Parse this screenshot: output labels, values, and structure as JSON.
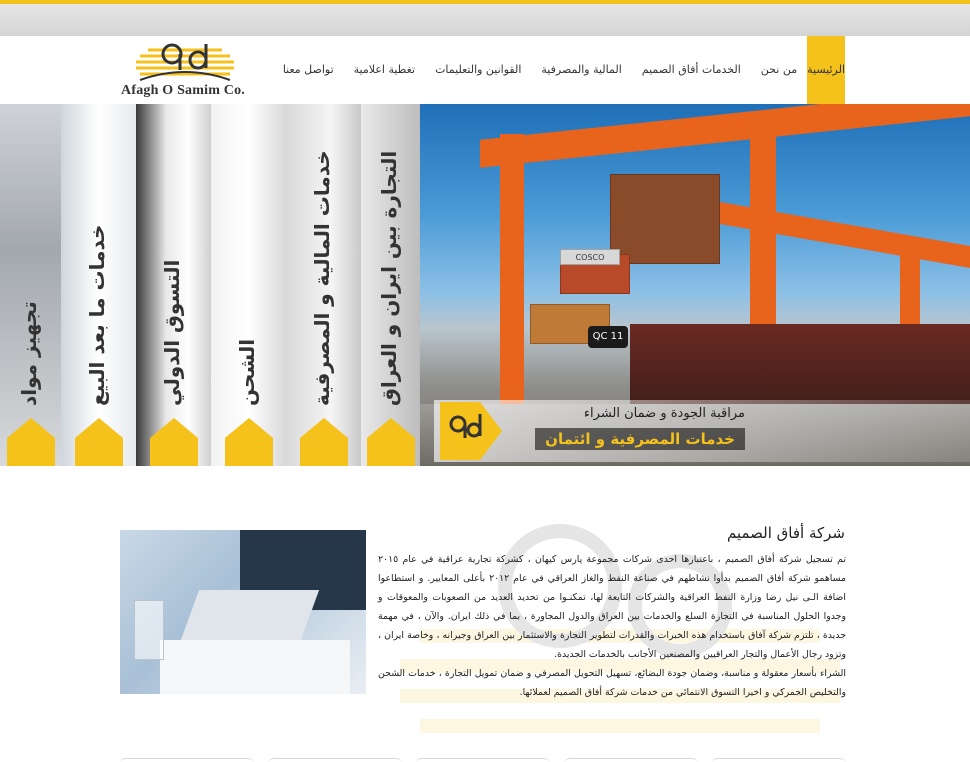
{
  "header": {
    "logo_text": "Afagh O Samim Co."
  },
  "nav": {
    "items": [
      {
        "label": "الرئيسية",
        "active": true
      },
      {
        "label": "من نحن",
        "active": false
      },
      {
        "label": "الخدمات أفاق الصميم",
        "active": false
      },
      {
        "label": "المالية والمصرفية",
        "active": false
      },
      {
        "label": "القوانين والتعليمات",
        "active": false
      },
      {
        "label": "تغطية اعلامية",
        "active": false
      },
      {
        "label": "تواصل معنا",
        "active": false
      }
    ]
  },
  "banner": {
    "strips": [
      {
        "label": "التجارة بين ايران و العراق"
      },
      {
        "label": "خدمات المالية و المصرفية"
      },
      {
        "label": "الشحن"
      },
      {
        "label": "التسوق الدولي"
      },
      {
        "label": "خدمات ما بعد البيع"
      },
      {
        "label": "تجهيز مواد"
      }
    ],
    "caption_line1": "مراقبة الجودة و ضمان الشراء",
    "caption_line2": "خدمات المصرفية و ائتمان",
    "container_label_cosco": "COSCO",
    "crane_label": "QC 11"
  },
  "about": {
    "title": "شركة أفاق الصميم",
    "paragraphs": [
      "تم تسجيل شركة أفاق الصميم ، باعتبارها احدى شركات مجموعة پارس كيهان ، كشركة تجارية عراقية في عام ٢٠١٥ مساهمو شركة أفاق الصميم بدأوا نشاطهم في صناعة النفط والغاز العراقي في عام ٢٠١٢ بأعلى المعايير. و استطاعوا اضافة الـى نيل رضا وزارة النفط العراقية والشركات التابعة لها، تمكنـوا من تحديد العديد من الصعوبات والمعوقات و وجدوا الحلول المناسبة في التجارة السلع والخدمات بين العراق والدول المجاورة ، بما في ذلك ايران. والآن ، في مهمة جديدة ، تلتزم شركة آفاق باستخدام هذه الخبرات والقدرات لتطوير التجارة والاستثمار بين العراق وجيرانه ، وخاصة ايران ، وتزود رجال الأعمال والتجار العراقيين والمصنعين الأجانب بالخدمات الجديدة.",
      "الشراء بأسعار معقولة و مناسبة، وضمان جودة البضائع، تسهيل التحويل المصرفي و ضمان تمويل التجارة ، خدمات الشحن والتخليص الجمركي و اخيرا التسوق الانتمائي من خدمات شركة أفاق الصميم لعملائها."
    ]
  },
  "colors": {
    "accent": "#f5c21b",
    "crane_orange": "#e8641c"
  }
}
